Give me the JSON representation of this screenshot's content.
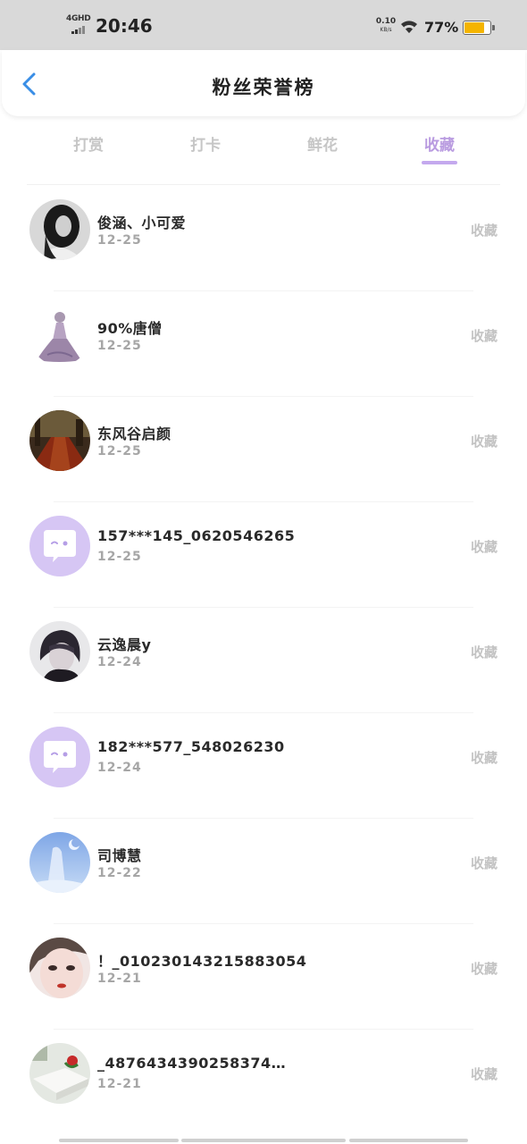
{
  "status_bar": {
    "network": "4GHD",
    "time": "20:46",
    "speed_value": "0.10",
    "speed_unit": "KB/s",
    "battery_percent": "77%",
    "battery_level": 0.77,
    "battery_color": "#f4b400"
  },
  "header": {
    "title": "粉丝荣誉榜",
    "back_icon": "chevron-left-icon",
    "accent": "#3a8ee6"
  },
  "tabs": [
    {
      "label": "打赏",
      "active": false
    },
    {
      "label": "打卡",
      "active": false
    },
    {
      "label": "鲜花",
      "active": false
    },
    {
      "label": "收藏",
      "active": true
    }
  ],
  "colors": {
    "active_tab": "#b99be0",
    "inactive_tab": "#c6c6c6",
    "name": "#2a2a2a",
    "date": "#a6a6a6"
  },
  "fans": [
    {
      "name": "俊涵、小可爱",
      "date": "12-25",
      "type": "收藏",
      "avatar": "photo-avatar-dark-hair"
    },
    {
      "name": "90%唐僧",
      "date": "12-25",
      "type": "收藏",
      "avatar": "photo-avatar-figure"
    },
    {
      "name": "东风谷启颜",
      "date": "12-25",
      "type": "收藏",
      "avatar": "photo-avatar-autumn-path"
    },
    {
      "name": "157***145_0620546265",
      "date": "12-25",
      "type": "收藏",
      "avatar": "default-chat-avatar-icon"
    },
    {
      "name": "云逸晨y",
      "date": "12-24",
      "type": "收藏",
      "avatar": "photo-avatar-anime-boy"
    },
    {
      "name": "182***577_548026230",
      "date": "12-24",
      "type": "收藏",
      "avatar": "default-chat-avatar-icon"
    },
    {
      "name": "司博慧",
      "date": "12-22",
      "type": "收藏",
      "avatar": "photo-avatar-blue-night"
    },
    {
      "name": "！_010230143215883054",
      "date": "12-21",
      "type": "收藏",
      "avatar": "photo-avatar-face"
    },
    {
      "name": "_4876434390258374…",
      "date": "12-21",
      "type": "收藏",
      "avatar": "photo-avatar-rose"
    }
  ]
}
